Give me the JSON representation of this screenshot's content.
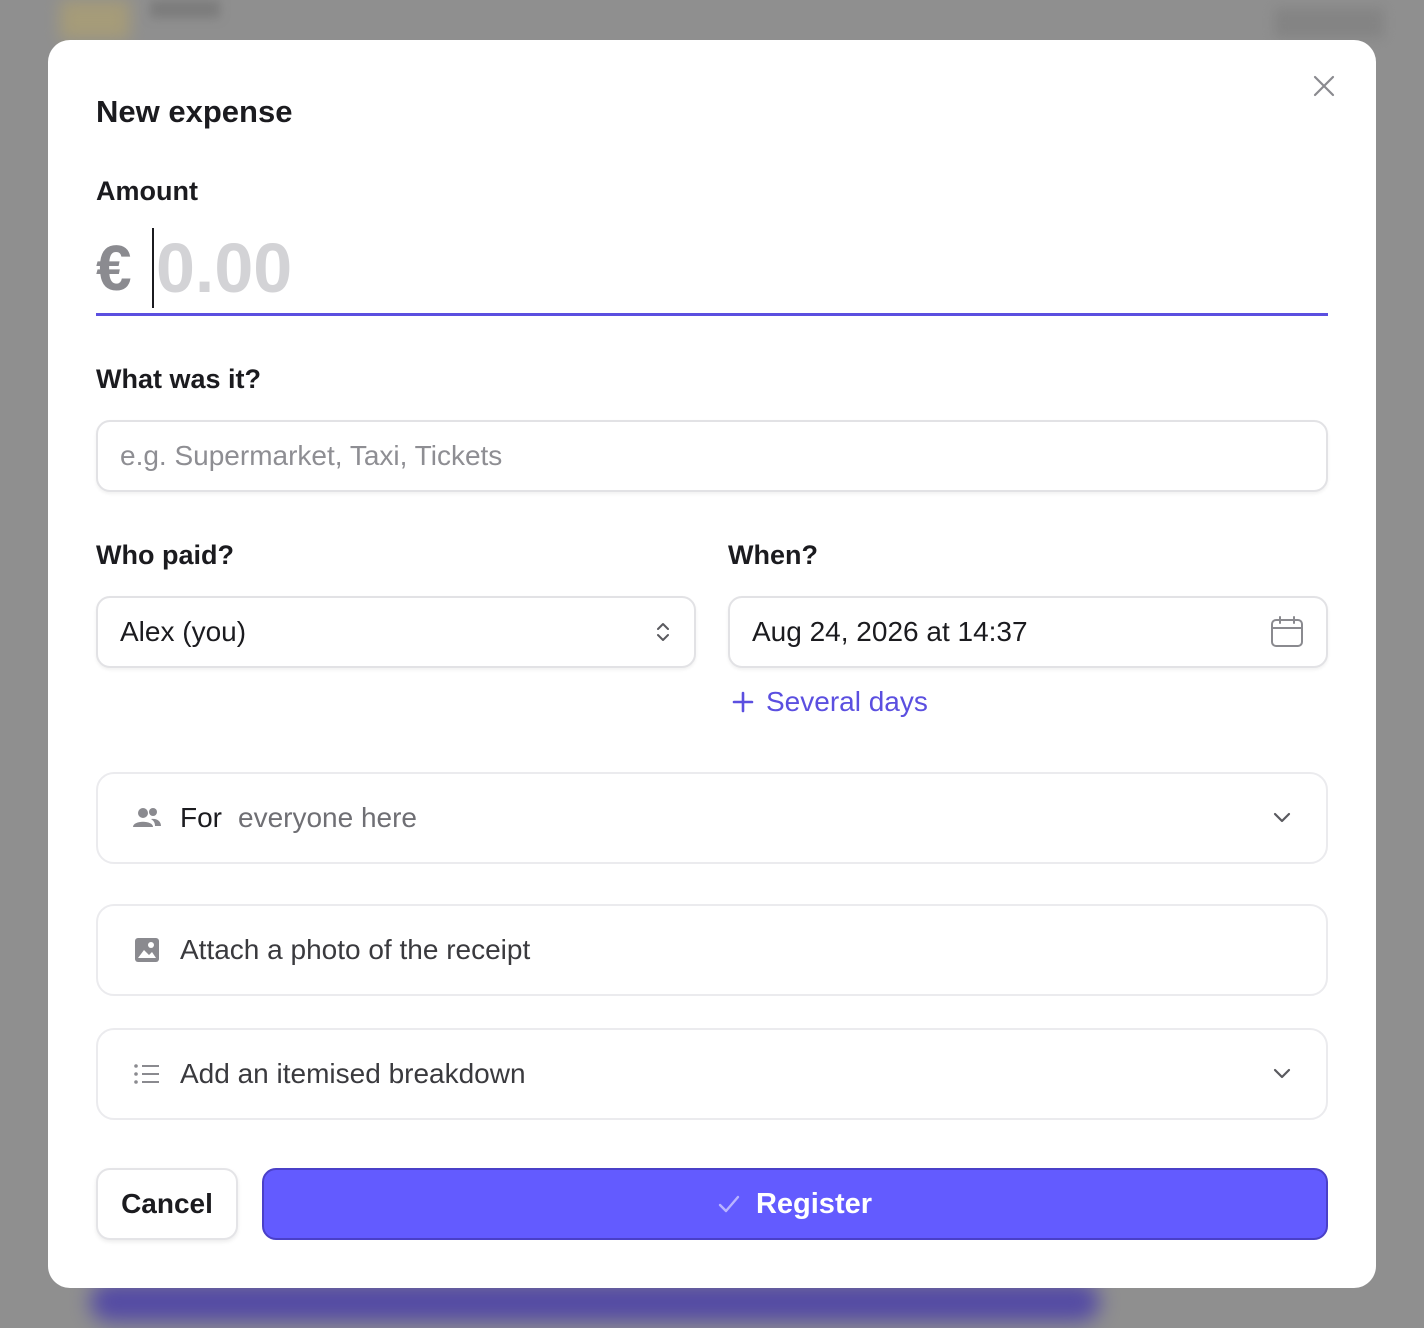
{
  "dialog": {
    "title": "New expense",
    "close_icon": "close-icon"
  },
  "amount": {
    "label": "Amount",
    "currency": "€",
    "placeholder": "0.00",
    "value": ""
  },
  "description": {
    "label": "What was it?",
    "placeholder": "e.g. Supermarket, Taxi, Tickets",
    "value": ""
  },
  "payer": {
    "label": "Who paid?",
    "selected": "Alex (you)",
    "icon": "chevron-updown-icon"
  },
  "date": {
    "label": "When?",
    "value": "Aug 24, 2026 at 14:37",
    "icon": "calendar-icon",
    "several_days_label": "Several days"
  },
  "split": {
    "icon": "people-icon",
    "prefix": "For",
    "value": "everyone here"
  },
  "receipt": {
    "icon": "image-icon",
    "label": "Attach a photo of the receipt"
  },
  "breakdown": {
    "icon": "list-icon",
    "label": "Add an itemised breakdown"
  },
  "actions": {
    "cancel_label": "Cancel",
    "register_label": "Register"
  },
  "colors": {
    "accent": "#635bff",
    "accent_border": "#4a40c8",
    "underline": "#5b4fe0"
  }
}
